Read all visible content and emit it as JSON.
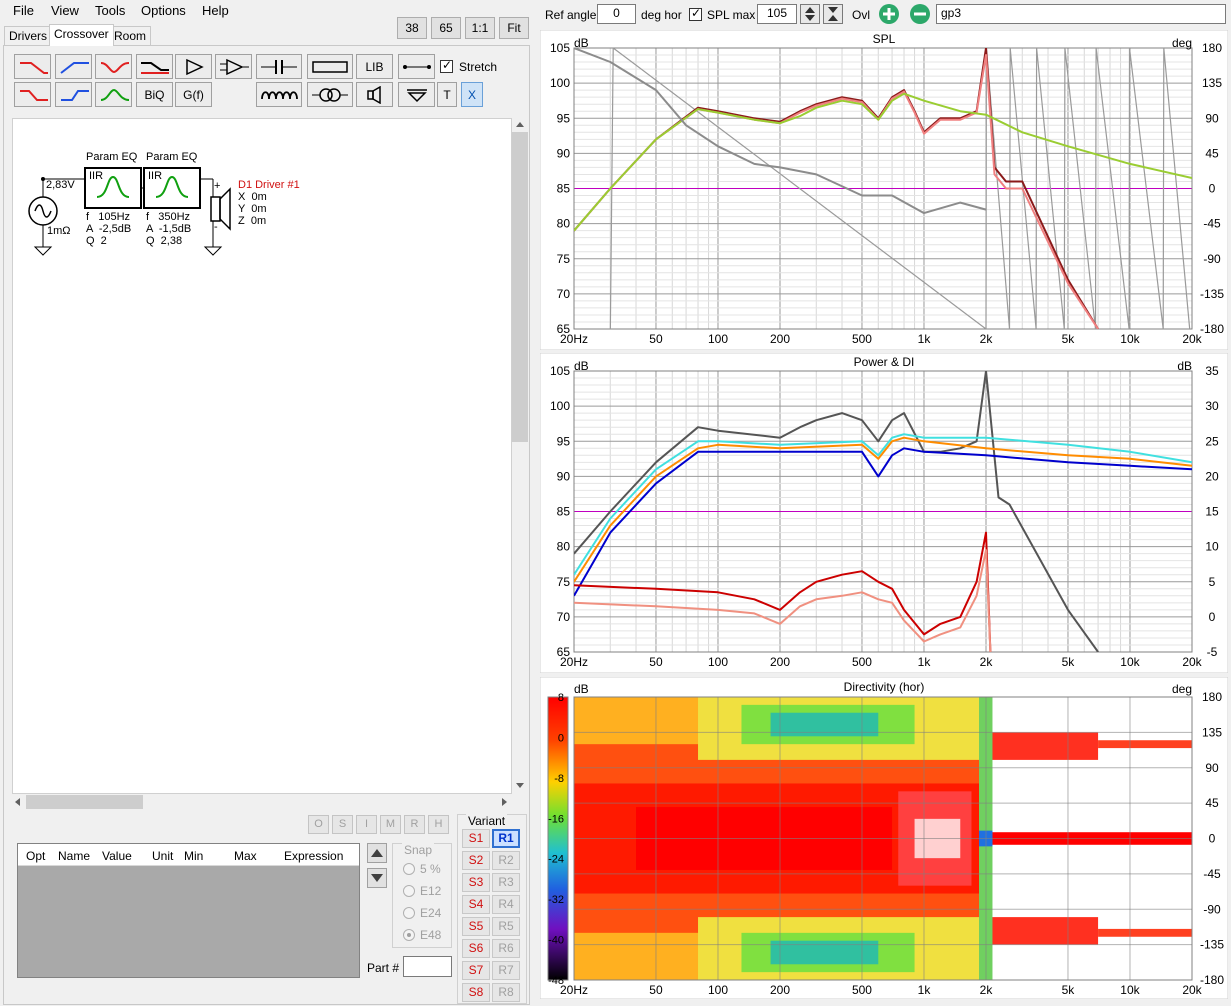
{
  "menu": [
    "File",
    "View",
    "Tools",
    "Options",
    "Help"
  ],
  "zoom_buttons": [
    "38",
    "65",
    "1:1",
    "Fit"
  ],
  "tabs": [
    "Drivers",
    "Crossover",
    "Room"
  ],
  "toolbar": {
    "stretch_label": "Stretch",
    "lib_label": "LIB",
    "biq_label": "BiQ",
    "gf_label": "G(f)",
    "t_label": "T",
    "x_label": "X"
  },
  "schematic": {
    "source_voltage": "2,83V",
    "source_impedance": "1mΩ",
    "eq1": {
      "title": "Param EQ",
      "type": "IIR",
      "f": "f   105Hz",
      "a": "A  -2,5dB",
      "q": "Q  2"
    },
    "eq2": {
      "title": "Param EQ",
      "type": "IIR",
      "f": "f   350Hz",
      "a": "A  -1,5dB",
      "q": "Q  2,38"
    },
    "driver": {
      "name": "D1 Driver #1",
      "x": "X  0m",
      "y": "Y  0m",
      "z": "Z  0m",
      "plus": "+",
      "minus": "-"
    }
  },
  "opt_buttons": [
    "O",
    "S",
    "I",
    "M",
    "R",
    "H"
  ],
  "table_headers": [
    "Opt",
    "Name",
    "Value",
    "Unit",
    "Min",
    "Max",
    "Expression"
  ],
  "snap": {
    "title": "Snap",
    "options": [
      "5 %",
      "E12",
      "E24",
      "E48"
    ],
    "selected": "E48"
  },
  "part_label": "Part #",
  "variant": {
    "title": "Variant",
    "s": [
      "S1",
      "S2",
      "S3",
      "S4",
      "S5",
      "S6",
      "S7",
      "S8"
    ],
    "r": [
      "R1",
      "R2",
      "R3",
      "R4",
      "R5",
      "R6",
      "R7",
      "R8"
    ],
    "active_r": "R1"
  },
  "topbar": {
    "ref_angle_label": "Ref angle",
    "ref_angle_value": "0",
    "deg_hor_label": "deg hor",
    "spl_max_label": "SPL max",
    "spl_max_value": "105",
    "ovl_label": "Ovl",
    "overlay_name": "gp3"
  },
  "freq_ticks": [
    "20Hz",
    "50",
    "100",
    "200",
    "500",
    "1k",
    "2k",
    "5k",
    "10k",
    "20k"
  ],
  "spl_graph": {
    "title": "SPL",
    "left_unit": "dB",
    "right_unit": "deg",
    "left_ticks": [
      "105",
      "100",
      "95",
      "90",
      "85",
      "80",
      "75",
      "70",
      "65"
    ],
    "right_ticks": [
      "180",
      "135",
      "90",
      "45",
      "0",
      "-45",
      "-90",
      "-135",
      "-180"
    ]
  },
  "power_graph": {
    "title": "Power & DI",
    "left_unit": "dB",
    "right_unit": "dB",
    "left_ticks": [
      "105",
      "100",
      "95",
      "90",
      "85",
      "80",
      "75",
      "70",
      "65"
    ],
    "right_ticks": [
      "35",
      "30",
      "25",
      "20",
      "15",
      "10",
      "5",
      "0",
      "-5"
    ]
  },
  "dir_graph": {
    "title": "Directivity (hor)",
    "left_unit": "dB",
    "right_unit": "deg",
    "scale_ticks": [
      "8",
      "0",
      "-8",
      "-16",
      "-24",
      "-32",
      "-40",
      "-48"
    ],
    "right_ticks": [
      "180",
      "135",
      "90",
      "45",
      "0",
      "-45",
      "-90",
      "-135",
      "-180"
    ]
  },
  "chart_data": [
    {
      "type": "line",
      "title": "SPL",
      "x_scale": "log",
      "xlim": [
        20,
        20000
      ],
      "ylim": [
        65,
        105
      ],
      "y2lim": [
        -180,
        180
      ],
      "series": [
        {
          "color": "#8b1a1a",
          "x": [
            20,
            30,
            50,
            80,
            100,
            150,
            200,
            250,
            300,
            400,
            500,
            600,
            700,
            800,
            900,
            1000,
            1200,
            1500,
            1800,
            2000,
            2200,
            2500,
            3000,
            5000,
            7000
          ],
          "y": [
            79,
            85,
            92,
            96.5,
            96,
            95,
            94.5,
            96,
            97,
            98,
            97.5,
            95,
            98,
            99,
            96,
            93,
            95,
            95,
            96,
            105,
            88,
            86,
            86,
            72,
            65
          ]
        },
        {
          "color": "#f08080",
          "x": [
            20,
            30,
            50,
            80,
            100,
            150,
            200,
            250,
            300,
            400,
            500,
            600,
            700,
            800,
            900,
            1000,
            1200,
            1500,
            1800,
            2000,
            2200,
            2500,
            3000,
            5000,
            7000
          ],
          "y": [
            79,
            85,
            92,
            96.3,
            95.8,
            94.8,
            94.3,
            95.8,
            96.8,
            97.8,
            97.3,
            94.8,
            97.8,
            98.8,
            95.8,
            92.8,
            94.8,
            94.8,
            95.8,
            104,
            87,
            85,
            85,
            71.5,
            65
          ]
        },
        {
          "color": "#9acd32",
          "x": [
            20,
            30,
            50,
            80,
            100,
            150,
            200,
            250,
            300,
            400,
            500,
            600,
            700,
            800,
            1000,
            1500,
            2000,
            3000,
            5000,
            10000,
            20000
          ],
          "y": [
            79,
            85,
            92,
            96.3,
            95.8,
            94.8,
            94.3,
            95.3,
            96.5,
            97.5,
            97,
            94.8,
            97.5,
            98.5,
            97.5,
            96,
            95.5,
            93,
            91,
            88.5,
            86.5
          ]
        },
        {
          "color": "#8c8c8c",
          "x": [
            20,
            30,
            50,
            70,
            100,
            150,
            200,
            300,
            500,
            700,
            1000,
            1500,
            2000
          ],
          "y": [
            105,
            103,
            99,
            94,
            91,
            88.5,
            88,
            87,
            84,
            84,
            81.5,
            83,
            82
          ]
        }
      ]
    },
    {
      "type": "line",
      "title": "Power & DI",
      "x_scale": "log",
      "xlim": [
        20,
        20000
      ],
      "ylim": [
        65,
        105
      ],
      "series": [
        {
          "color": "#555555",
          "x": [
            20,
            30,
            50,
            80,
            100,
            200,
            250,
            300,
            400,
            500,
            600,
            700,
            800,
            1000,
            1200,
            1500,
            1800,
            2000,
            2300,
            2600,
            5000,
            7000
          ],
          "y": [
            79,
            85,
            92,
            97,
            96.5,
            95.5,
            97,
            98,
            99,
            98,
            95,
            98,
            99,
            93.5,
            93.5,
            94,
            95,
            105,
            87,
            86,
            71,
            65
          ]
        },
        {
          "color": "#40e0e0",
          "x": [
            20,
            30,
            50,
            80,
            100,
            200,
            500,
            600,
            700,
            800,
            1000,
            2000,
            5000,
            10000,
            20000
          ],
          "y": [
            76,
            84,
            91,
            95,
            95,
            94.5,
            95,
            93,
            95.5,
            96,
            95.5,
            95.5,
            94.5,
            93.5,
            92
          ]
        },
        {
          "color": "#ff8c00",
          "x": [
            20,
            30,
            50,
            80,
            100,
            200,
            500,
            600,
            700,
            800,
            1000,
            2000,
            5000,
            10000,
            20000
          ],
          "y": [
            75,
            83,
            90,
            94,
            94.5,
            94,
            94.5,
            92.5,
            95,
            95.5,
            95,
            94,
            93,
            92.5,
            91.5
          ]
        },
        {
          "color": "#0000cd",
          "x": [
            20,
            30,
            50,
            80,
            100,
            200,
            500,
            600,
            700,
            800,
            1000,
            2000,
            5000,
            10000,
            20000
          ],
          "y": [
            73,
            82,
            89,
            93.5,
            93.5,
            93.5,
            93.5,
            90,
            93,
            94,
            93.5,
            93,
            92,
            91.5,
            91
          ]
        },
        {
          "color": "#cc0000",
          "x": [
            20,
            50,
            100,
            150,
            200,
            250,
            300,
            400,
            500,
            600,
            700,
            800,
            1000,
            1200,
            1500,
            1800,
            2000,
            2100
          ],
          "y": [
            74.5,
            74,
            73.5,
            72.5,
            71,
            73.5,
            75,
            76,
            76.5,
            75,
            74,
            71,
            67.5,
            69,
            70,
            75,
            82,
            65
          ]
        },
        {
          "color": "#f09080",
          "x": [
            20,
            50,
            100,
            150,
            200,
            250,
            300,
            400,
            500,
            600,
            700,
            800,
            1000,
            1200,
            1500,
            1800,
            2000,
            2100
          ],
          "y": [
            72,
            71.5,
            71,
            70.5,
            69,
            71.5,
            72.5,
            73,
            73.5,
            72.5,
            72,
            69.5,
            66.5,
            67.5,
            68.5,
            73,
            79.5,
            65
          ]
        }
      ]
    },
    {
      "type": "heatmap",
      "title": "Directivity (hor)",
      "x_scale": "log",
      "xlim": [
        20,
        20000
      ],
      "ylim": [
        -180,
        180
      ],
      "zlim": [
        -48,
        8
      ]
    }
  ]
}
